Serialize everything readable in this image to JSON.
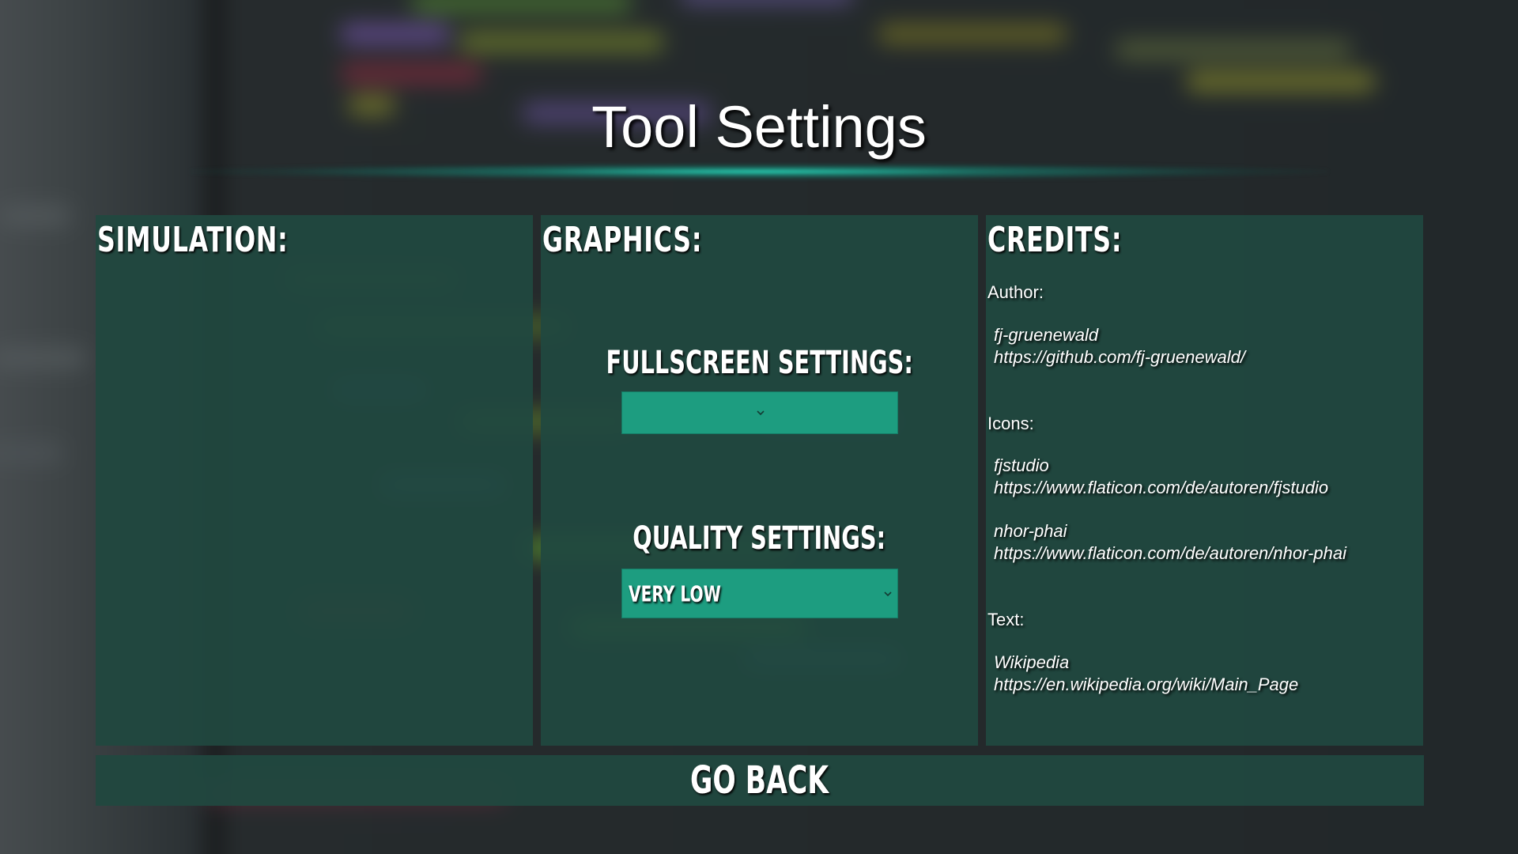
{
  "page": {
    "title": "Tool Settings"
  },
  "panels": {
    "simulation": {
      "heading": "SIMULATION:"
    },
    "graphics": {
      "heading": "GRAPHICS:",
      "fullscreen": {
        "label": "FULLSCREEN SETTINGS:",
        "value": ""
      },
      "quality": {
        "label": "QUALITY SETTINGS:",
        "value": "VERY LOW"
      }
    },
    "credits": {
      "heading": "CREDITS:",
      "author_label": "Author:",
      "author": {
        "name": "fj-gruenewald",
        "url": "https://github.com/fj-gruenewald/"
      },
      "icons_label": "Icons:",
      "icons": [
        {
          "name": "fjstudio",
          "url": "https://www.flaticon.com/de/autoren/fjstudio"
        },
        {
          "name": "nhor-phai",
          "url": "https://www.flaticon.com/de/autoren/nhor-phai"
        }
      ],
      "text_label": "Text:",
      "text": {
        "name": "Wikipedia",
        "url": "https://en.wikipedia.org/wiki/Main_Page"
      }
    }
  },
  "footer": {
    "go_back_label": "GO BACK"
  },
  "icons": {
    "dropdown": "chevron-down-icon"
  },
  "colors": {
    "panel_bg": "#20483f",
    "dropdown_bg": "#1d9d80",
    "accent_glow": "#28dcbe",
    "text": "#ffffff"
  }
}
